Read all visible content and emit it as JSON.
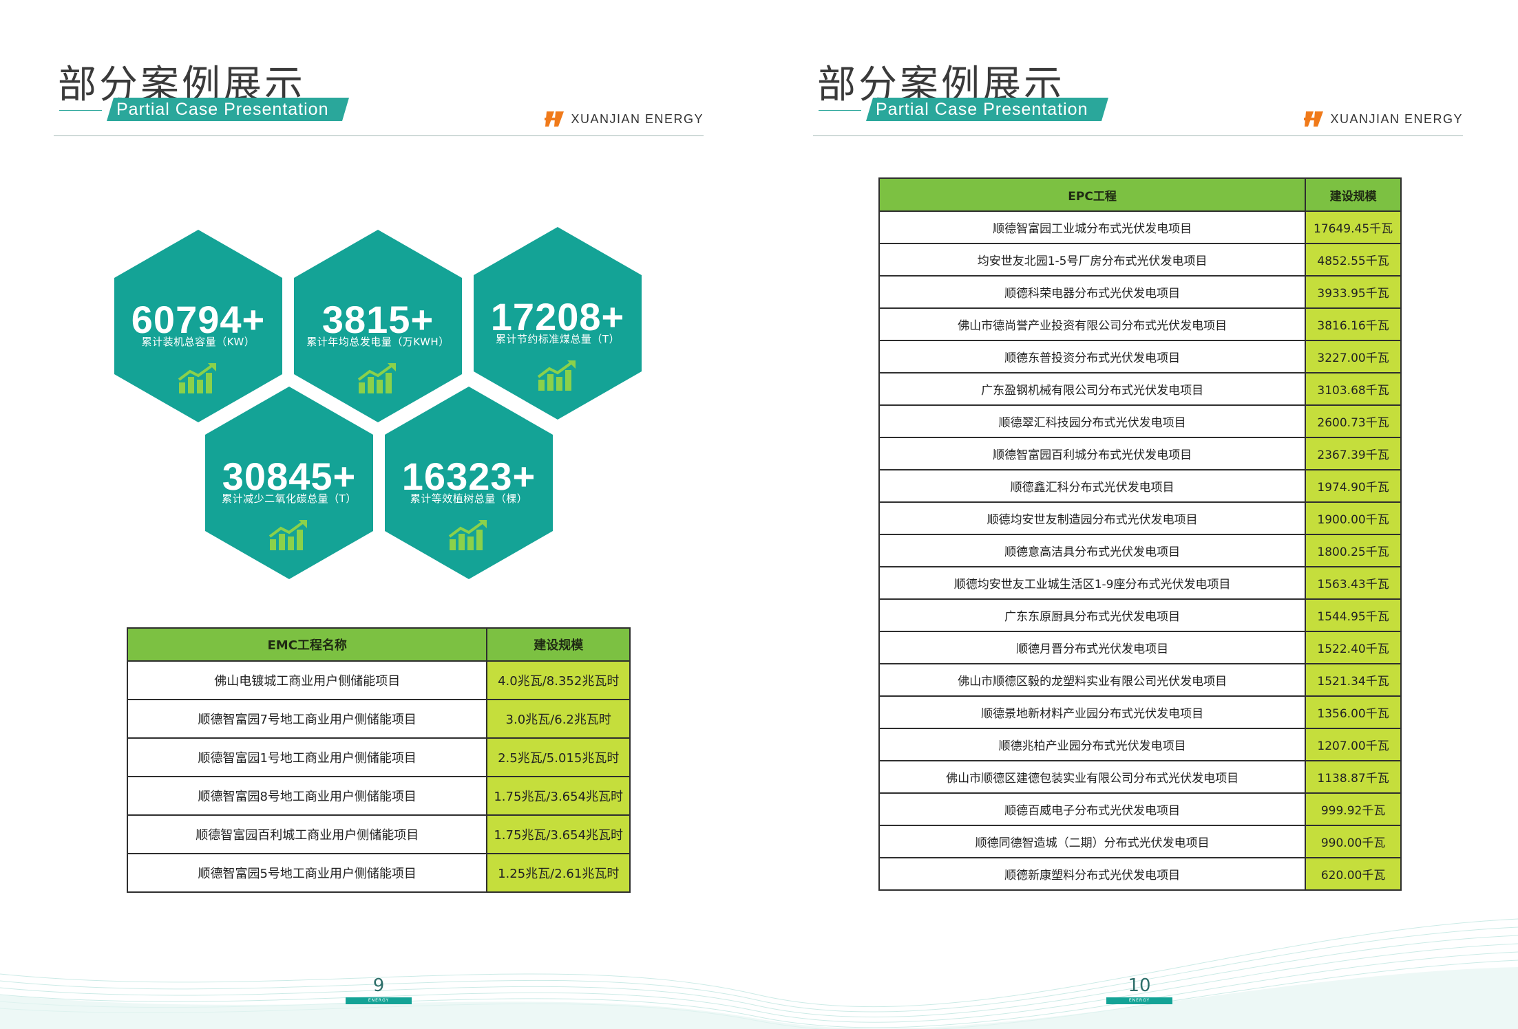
{
  "left_page": {
    "title": "部分案例展示",
    "subtitle": "Partial Case Presentation",
    "brand": "XUANJIAN ENERGY",
    "stats": [
      {
        "value": "60794+",
        "label": "累计装机总容量（KW）"
      },
      {
        "value": "3815+",
        "label": "累计年均总发电量（万KWH）"
      },
      {
        "value": "17208+",
        "label": "累计节约标准煤总量（T）"
      },
      {
        "value": "30845+",
        "label": "累计减少二氧化碳总量（T）"
      },
      {
        "value": "16323+",
        "label": "累计等效植树总量（棵）"
      }
    ],
    "table": {
      "headers": [
        "EMC工程名称",
        "建设规模"
      ],
      "rows": [
        [
          "佛山电镀城工商业用户侧储能项目",
          "4.0兆瓦/8.352兆瓦时"
        ],
        [
          "顺德智富园7号地工商业用户侧储能项目",
          "3.0兆瓦/6.2兆瓦时"
        ],
        [
          "顺德智富园1号地工商业用户侧储能项目",
          "2.5兆瓦/5.015兆瓦时"
        ],
        [
          "顺德智富园8号地工商业用户侧储能项目",
          "1.75兆瓦/3.654兆瓦时"
        ],
        [
          "顺德智富园百利城工商业用户侧储能项目",
          "1.75兆瓦/3.654兆瓦时"
        ],
        [
          "顺德智富园5号地工商业用户侧储能项目",
          "1.25兆瓦/2.61兆瓦时"
        ]
      ]
    },
    "page_number": "9",
    "page_tag": "ENERGY"
  },
  "right_page": {
    "title": "部分案例展示",
    "subtitle": "Partial Case Presentation",
    "brand": "XUANJIAN ENERGY",
    "table": {
      "headers": [
        "EPC工程",
        "建设规模"
      ],
      "rows": [
        [
          "顺德智富园工业城分布式光伏发电项目",
          "17649.45千瓦"
        ],
        [
          "均安世友北园1-5号厂房分布式光伏发电项目",
          "4852.55千瓦"
        ],
        [
          "顺德科荣电器分布式光伏发电项目",
          "3933.95千瓦"
        ],
        [
          "佛山市德尚誉产业投资有限公司分布式光伏发电项目",
          "3816.16千瓦"
        ],
        [
          "顺德东普投资分布式光伏发电项目",
          "3227.00千瓦"
        ],
        [
          "广东盈钢机械有限公司分布式光伏发电项目",
          "3103.68千瓦"
        ],
        [
          "顺德翠汇科技园分布式光伏发电项目",
          "2600.73千瓦"
        ],
        [
          "顺德智富园百利城分布式光伏发电项目",
          "2367.39千瓦"
        ],
        [
          "顺德鑫汇科分布式光伏发电项目",
          "1974.90千瓦"
        ],
        [
          "顺德均安世友制造园分布式光伏发电项目",
          "1900.00千瓦"
        ],
        [
          "顺德意高洁具分布式光伏发电项目",
          "1800.25千瓦"
        ],
        [
          "顺德均安世友工业城生活区1-9座分布式光伏发电项目",
          "1563.43千瓦"
        ],
        [
          "广东东原厨具分布式光伏发电项目",
          "1544.95千瓦"
        ],
        [
          "顺德月晋分布式光伏发电项目",
          "1522.40千瓦"
        ],
        [
          "佛山市顺德区毅的龙塑料实业有限公司光伏发电项目",
          "1521.34千瓦"
        ],
        [
          "顺德景地新材料产业园分布式光伏发电项目",
          "1356.00千瓦"
        ],
        [
          "顺德兆柏产业园分布式光伏发电项目",
          "1207.00千瓦"
        ],
        [
          "佛山市顺德区建德包装实业有限公司分布式光伏发电项目",
          "1138.87千瓦"
        ],
        [
          "顺德百威电子分布式光伏发电项目",
          "999.92千瓦"
        ],
        [
          "顺德同德智造城（二期）分布式光伏发电项目",
          "990.00千瓦"
        ],
        [
          "顺德新康塑料分布式光伏发电项目",
          "620.00千瓦"
        ]
      ]
    },
    "page_number": "10",
    "page_tag": "ENERGY"
  },
  "colors": {
    "teal": "#14a396",
    "header_green": "#7cc142",
    "value_lime": "#c5de3c",
    "logo_orange": "#f07a1a"
  }
}
